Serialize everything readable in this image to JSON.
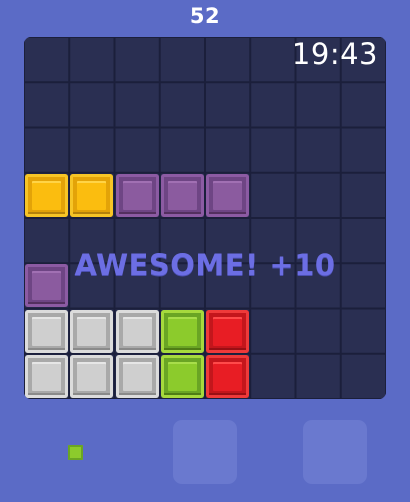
{
  "game": {
    "score": "52",
    "timer": "19:43",
    "combo_text": "AWESOME! +10"
  },
  "board": {
    "columns": 8,
    "rows": 8,
    "blocks": [
      {
        "row": 3,
        "col": 0,
        "color": "yellow"
      },
      {
        "row": 3,
        "col": 1,
        "color": "yellow"
      },
      {
        "row": 3,
        "col": 2,
        "color": "purple"
      },
      {
        "row": 3,
        "col": 3,
        "color": "purple"
      },
      {
        "row": 3,
        "col": 4,
        "color": "purple"
      },
      {
        "row": 5,
        "col": 0,
        "color": "purple"
      },
      {
        "row": 6,
        "col": 0,
        "color": "grey"
      },
      {
        "row": 6,
        "col": 1,
        "color": "grey"
      },
      {
        "row": 6,
        "col": 2,
        "color": "grey"
      },
      {
        "row": 6,
        "col": 3,
        "color": "green"
      },
      {
        "row": 6,
        "col": 4,
        "color": "red"
      },
      {
        "row": 7,
        "col": 0,
        "color": "grey"
      },
      {
        "row": 7,
        "col": 1,
        "color": "grey"
      },
      {
        "row": 7,
        "col": 2,
        "color": "grey"
      },
      {
        "row": 7,
        "col": 3,
        "color": "green"
      },
      {
        "row": 7,
        "col": 4,
        "color": "red"
      }
    ]
  },
  "tray": {
    "pieces": [
      {
        "slot": 1,
        "shape": "single-block",
        "color": "green"
      },
      {
        "slot": 2,
        "shape": "empty"
      },
      {
        "slot": 3,
        "shape": "empty"
      }
    ]
  },
  "colors": {
    "background": "#5b6bc6",
    "board": "#2a2f52",
    "combo_text": "#6c6ee4"
  }
}
